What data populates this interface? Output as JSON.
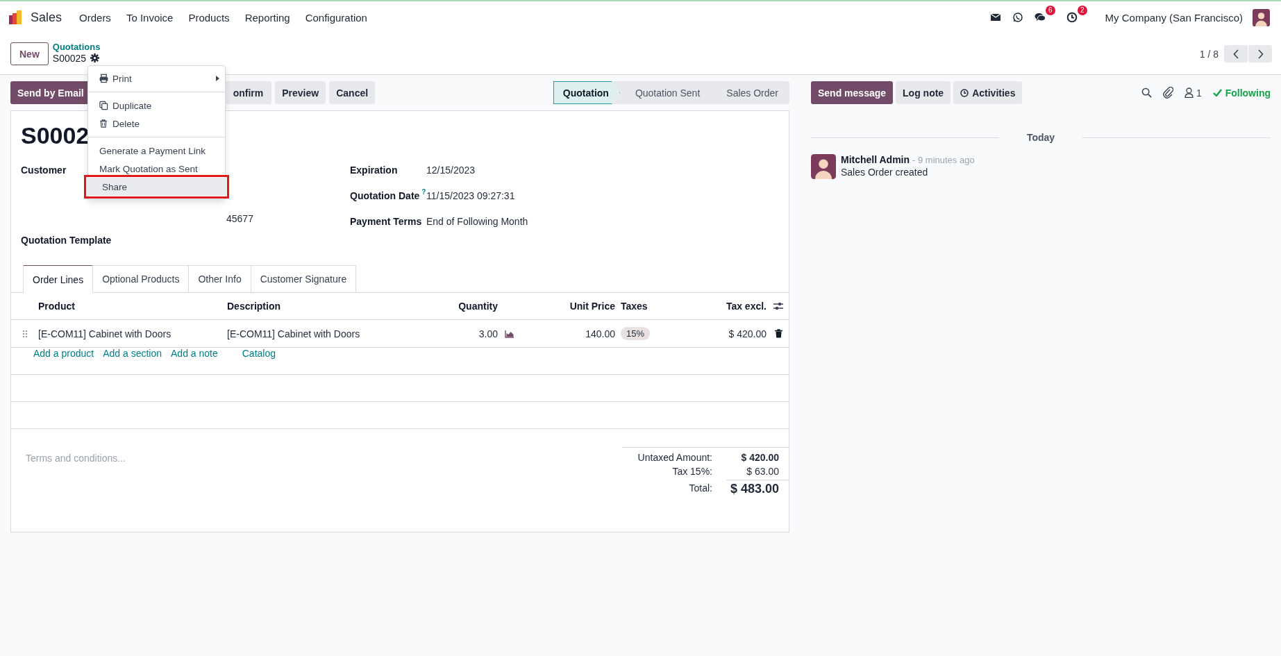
{
  "navbar": {
    "app_name": "Sales",
    "menu": [
      "Orders",
      "To Invoice",
      "Products",
      "Reporting",
      "Configuration"
    ],
    "systray": [
      {
        "kind": "mail"
      },
      {
        "kind": "whatsapp"
      },
      {
        "kind": "chat",
        "badge": "6"
      },
      {
        "kind": "clock",
        "badge": "2"
      }
    ],
    "company": "My Company (San Francisco)"
  },
  "control_panel": {
    "new_button": "New",
    "breadcrumb": "Quotations",
    "record": "S00025",
    "pager": "1 / 8"
  },
  "action_buttons": [
    {
      "label": "Send by Email",
      "kind": "primary"
    },
    {
      "label": "onfirm",
      "kind": "secondary"
    },
    {
      "label": "Preview",
      "kind": "secondary"
    },
    {
      "label": "Cancel",
      "kind": "secondary"
    }
  ],
  "status_steps": [
    {
      "label": "Quotation",
      "selected": true
    },
    {
      "label": "Quotation Sent",
      "selected": false
    },
    {
      "label": "Sales Order",
      "selected": false
    }
  ],
  "form": {
    "title": "S0002",
    "customer_label": "Customer",
    "customer_partial": "45677",
    "template_label": "Quotation Template",
    "fields": [
      {
        "label": "Expiration",
        "value": "12/15/2023"
      },
      {
        "label": "Quotation Date",
        "help": "?",
        "value": "11/15/2023 09:27:31"
      },
      {
        "label": "Payment Terms",
        "value": "End of Following Month"
      }
    ],
    "tabs": [
      {
        "label": "Order Lines",
        "selected": true
      },
      {
        "label": "Optional Products",
        "selected": false
      },
      {
        "label": "Other Info",
        "selected": false
      },
      {
        "label": "Customer Signature",
        "selected": false
      }
    ],
    "table": {
      "columns": [
        "Product",
        "Description",
        "Quantity",
        "Unit Price",
        "Taxes",
        "Tax excl."
      ],
      "rows": [
        {
          "product": "[E-COM11] Cabinet with Doors",
          "description": "[E-COM11] Cabinet with Doors",
          "quantity": "3.00",
          "unit_price": "140.00",
          "taxes": "15%",
          "tax_excl": "$ 420.00"
        }
      ],
      "add_links": [
        "Add a product",
        "Add a section",
        "Add a note",
        "Catalog"
      ]
    },
    "terms_placeholder": "Terms and conditions...",
    "totals": [
      {
        "label": "Untaxed Amount:",
        "value": "$ 420.00",
        "kind": "subtotal"
      },
      {
        "label": "Tax 15%:",
        "value": "$ 63.00",
        "kind": "tax"
      },
      {
        "label": "Total:",
        "value": "$ 483.00",
        "kind": "total"
      }
    ]
  },
  "dropdown": {
    "sections": [
      [
        {
          "label": "Print",
          "kind": "print",
          "selected": false,
          "annotated": false
        }
      ],
      [
        {
          "label": "Duplicate",
          "kind": "duplicate",
          "selected": false,
          "annotated": false
        },
        {
          "label": "Delete",
          "kind": "delete",
          "selected": false,
          "annotated": false
        }
      ],
      [
        {
          "label": "Generate a Payment Link",
          "kind": "plain",
          "selected": false,
          "annotated": false
        },
        {
          "label": "Mark Quotation as Sent",
          "kind": "plain",
          "selected": false,
          "annotated": false
        },
        {
          "label": "Share",
          "kind": "plain",
          "selected": true,
          "annotated": true
        }
      ]
    ]
  },
  "chatter": {
    "buttons": [
      {
        "label": "Send message",
        "kind": "primary"
      },
      {
        "label": "Log note",
        "kind": "secondary"
      },
      {
        "label": "Activities",
        "kind": "activities"
      }
    ],
    "followers_count": "1",
    "follow_label": "Following",
    "date_separator": "Today",
    "messages": [
      {
        "author": "Mitchell Admin",
        "time": "- 9 minutes ago",
        "body": "Sales Order created"
      }
    ]
  }
}
